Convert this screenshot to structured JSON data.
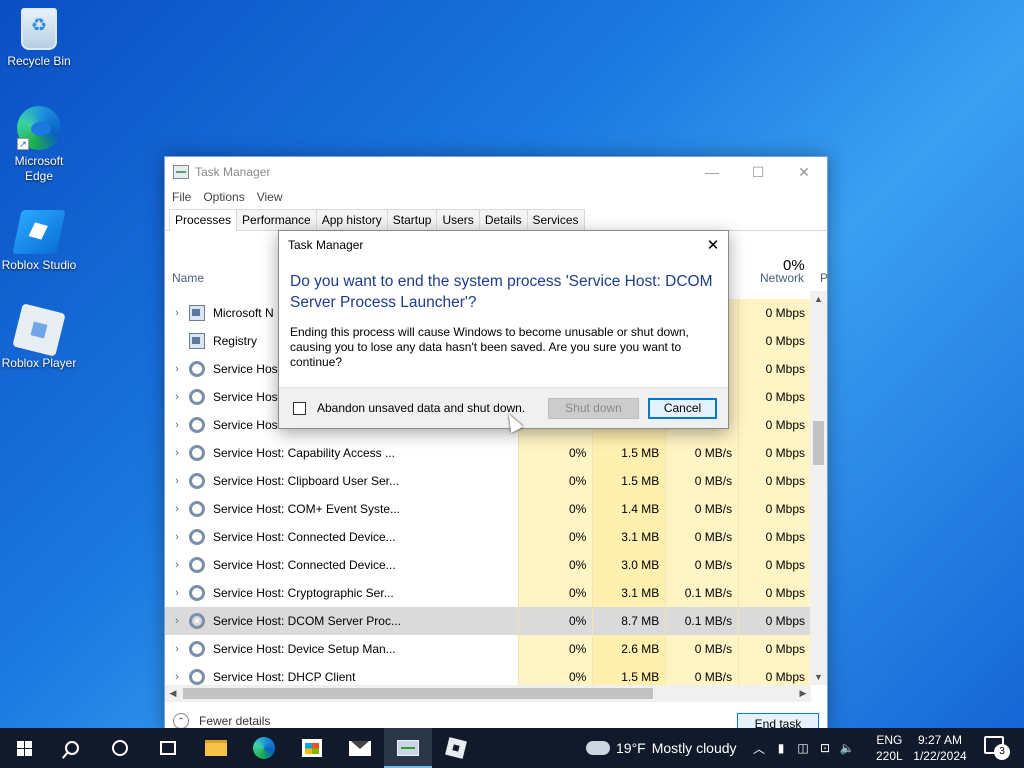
{
  "desktop": {
    "icons": [
      {
        "label": "Recycle Bin"
      },
      {
        "label": "Microsoft\nEdge"
      },
      {
        "label": "Roblox Studio"
      },
      {
        "label": "Roblox Player"
      }
    ]
  },
  "task_manager": {
    "title": "Task Manager",
    "menu": [
      "File",
      "Options",
      "View"
    ],
    "tabs": [
      "Processes",
      "Performance",
      "App history",
      "Startup",
      "Users",
      "Details",
      "Services"
    ],
    "active_tab": "Processes",
    "columns": {
      "name": "Name",
      "network_pct": "0%",
      "network": "Network",
      "next": "P"
    },
    "rows": [
      {
        "name": "Microsoft N",
        "icon": "window-icon",
        "cpu": "",
        "memory": "",
        "disk": "",
        "network": "0 Mbps",
        "expandable": true
      },
      {
        "name": "Registry",
        "icon": "window-icon",
        "cpu": "",
        "memory": "",
        "disk": "",
        "network": "0 Mbps",
        "expandable": false
      },
      {
        "name": "Service Host",
        "icon": "gear-icon",
        "cpu": "",
        "memory": "",
        "disk": "",
        "network": "0 Mbps",
        "expandable": true
      },
      {
        "name": "Service Host",
        "icon": "gear-icon",
        "cpu": "",
        "memory": "",
        "disk": "",
        "network": "0 Mbps",
        "expandable": true
      },
      {
        "name": "Service Host",
        "icon": "gear-icon",
        "cpu": "",
        "memory": "",
        "disk": "",
        "network": "0 Mbps",
        "expandable": true
      },
      {
        "name": "Service Host: Capability Access ...",
        "icon": "gear-icon",
        "cpu": "0%",
        "memory": "1.5 MB",
        "disk": "0 MB/s",
        "network": "0 Mbps",
        "expandable": true
      },
      {
        "name": "Service Host: Clipboard User Ser...",
        "icon": "gear-icon",
        "cpu": "0%",
        "memory": "1.5 MB",
        "disk": "0 MB/s",
        "network": "0 Mbps",
        "expandable": true
      },
      {
        "name": "Service Host: COM+ Event Syste...",
        "icon": "gear-icon",
        "cpu": "0%",
        "memory": "1.4 MB",
        "disk": "0 MB/s",
        "network": "0 Mbps",
        "expandable": true
      },
      {
        "name": "Service Host: Connected Device...",
        "icon": "gear-icon",
        "cpu": "0%",
        "memory": "3.1 MB",
        "disk": "0 MB/s",
        "network": "0 Mbps",
        "expandable": true
      },
      {
        "name": "Service Host: Connected Device...",
        "icon": "gear-icon",
        "cpu": "0%",
        "memory": "3.0 MB",
        "disk": "0 MB/s",
        "network": "0 Mbps",
        "expandable": true
      },
      {
        "name": "Service Host: Cryptographic Ser...",
        "icon": "gear-icon",
        "cpu": "0%",
        "memory": "3.1 MB",
        "disk": "0.1 MB/s",
        "network": "0 Mbps",
        "expandable": true
      },
      {
        "name": "Service Host: DCOM Server Proc...",
        "icon": "gear-icon",
        "cpu": "0%",
        "memory": "8.7 MB",
        "disk": "0.1 MB/s",
        "network": "0 Mbps",
        "expandable": true,
        "selected": true
      },
      {
        "name": "Service Host: Device Setup Man...",
        "icon": "gear-icon",
        "cpu": "0%",
        "memory": "2.6 MB",
        "disk": "0 MB/s",
        "network": "0 Mbps",
        "expandable": true
      },
      {
        "name": "Service Host: DHCP Client",
        "icon": "gear-icon",
        "cpu": "0%",
        "memory": "1.5 MB",
        "disk": "0 MB/s",
        "network": "0 Mbps",
        "expandable": true
      }
    ],
    "footer": {
      "fewer_details": "Fewer details",
      "end_task": "End task"
    }
  },
  "dialog": {
    "title": "Task Manager",
    "question": "Do you want to end the system process 'Service Host: DCOM Server Process Launcher'?",
    "message": "Ending this process will cause Windows to become unusable or shut down, causing you to lose any data hasn't been saved. Are you sure you want to continue?",
    "checkbox_label": "Abandon unsaved data and shut down.",
    "shutdown_button": "Shut down",
    "cancel_button": "Cancel"
  },
  "taskbar": {
    "weather_temp": "19°F",
    "weather_text": "Mostly cloudy",
    "lang_top": "ENG",
    "lang_bottom": "220L",
    "time": "9:27 AM",
    "date": "1/22/2024",
    "notification_count": "3"
  }
}
